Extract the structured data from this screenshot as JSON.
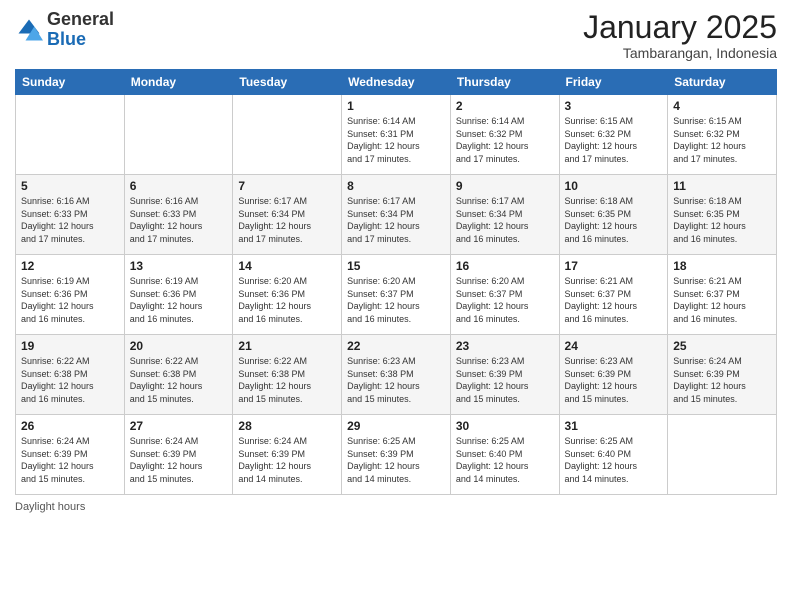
{
  "header": {
    "logo_general": "General",
    "logo_blue": "Blue",
    "month_title": "January 2025",
    "subtitle": "Tambarangan, Indonesia"
  },
  "days_of_week": [
    "Sunday",
    "Monday",
    "Tuesday",
    "Wednesday",
    "Thursday",
    "Friday",
    "Saturday"
  ],
  "weeks": [
    {
      "shade": "white",
      "days": [
        {
          "num": "",
          "info": ""
        },
        {
          "num": "",
          "info": ""
        },
        {
          "num": "",
          "info": ""
        },
        {
          "num": "1",
          "info": "Sunrise: 6:14 AM\nSunset: 6:31 PM\nDaylight: 12 hours\nand 17 minutes."
        },
        {
          "num": "2",
          "info": "Sunrise: 6:14 AM\nSunset: 6:32 PM\nDaylight: 12 hours\nand 17 minutes."
        },
        {
          "num": "3",
          "info": "Sunrise: 6:15 AM\nSunset: 6:32 PM\nDaylight: 12 hours\nand 17 minutes."
        },
        {
          "num": "4",
          "info": "Sunrise: 6:15 AM\nSunset: 6:32 PM\nDaylight: 12 hours\nand 17 minutes."
        }
      ]
    },
    {
      "shade": "shade",
      "days": [
        {
          "num": "5",
          "info": "Sunrise: 6:16 AM\nSunset: 6:33 PM\nDaylight: 12 hours\nand 17 minutes."
        },
        {
          "num": "6",
          "info": "Sunrise: 6:16 AM\nSunset: 6:33 PM\nDaylight: 12 hours\nand 17 minutes."
        },
        {
          "num": "7",
          "info": "Sunrise: 6:17 AM\nSunset: 6:34 PM\nDaylight: 12 hours\nand 17 minutes."
        },
        {
          "num": "8",
          "info": "Sunrise: 6:17 AM\nSunset: 6:34 PM\nDaylight: 12 hours\nand 17 minutes."
        },
        {
          "num": "9",
          "info": "Sunrise: 6:17 AM\nSunset: 6:34 PM\nDaylight: 12 hours\nand 16 minutes."
        },
        {
          "num": "10",
          "info": "Sunrise: 6:18 AM\nSunset: 6:35 PM\nDaylight: 12 hours\nand 16 minutes."
        },
        {
          "num": "11",
          "info": "Sunrise: 6:18 AM\nSunset: 6:35 PM\nDaylight: 12 hours\nand 16 minutes."
        }
      ]
    },
    {
      "shade": "white",
      "days": [
        {
          "num": "12",
          "info": "Sunrise: 6:19 AM\nSunset: 6:36 PM\nDaylight: 12 hours\nand 16 minutes."
        },
        {
          "num": "13",
          "info": "Sunrise: 6:19 AM\nSunset: 6:36 PM\nDaylight: 12 hours\nand 16 minutes."
        },
        {
          "num": "14",
          "info": "Sunrise: 6:20 AM\nSunset: 6:36 PM\nDaylight: 12 hours\nand 16 minutes."
        },
        {
          "num": "15",
          "info": "Sunrise: 6:20 AM\nSunset: 6:37 PM\nDaylight: 12 hours\nand 16 minutes."
        },
        {
          "num": "16",
          "info": "Sunrise: 6:20 AM\nSunset: 6:37 PM\nDaylight: 12 hours\nand 16 minutes."
        },
        {
          "num": "17",
          "info": "Sunrise: 6:21 AM\nSunset: 6:37 PM\nDaylight: 12 hours\nand 16 minutes."
        },
        {
          "num": "18",
          "info": "Sunrise: 6:21 AM\nSunset: 6:37 PM\nDaylight: 12 hours\nand 16 minutes."
        }
      ]
    },
    {
      "shade": "shade",
      "days": [
        {
          "num": "19",
          "info": "Sunrise: 6:22 AM\nSunset: 6:38 PM\nDaylight: 12 hours\nand 16 minutes."
        },
        {
          "num": "20",
          "info": "Sunrise: 6:22 AM\nSunset: 6:38 PM\nDaylight: 12 hours\nand 15 minutes."
        },
        {
          "num": "21",
          "info": "Sunrise: 6:22 AM\nSunset: 6:38 PM\nDaylight: 12 hours\nand 15 minutes."
        },
        {
          "num": "22",
          "info": "Sunrise: 6:23 AM\nSunset: 6:38 PM\nDaylight: 12 hours\nand 15 minutes."
        },
        {
          "num": "23",
          "info": "Sunrise: 6:23 AM\nSunset: 6:39 PM\nDaylight: 12 hours\nand 15 minutes."
        },
        {
          "num": "24",
          "info": "Sunrise: 6:23 AM\nSunset: 6:39 PM\nDaylight: 12 hours\nand 15 minutes."
        },
        {
          "num": "25",
          "info": "Sunrise: 6:24 AM\nSunset: 6:39 PM\nDaylight: 12 hours\nand 15 minutes."
        }
      ]
    },
    {
      "shade": "white",
      "days": [
        {
          "num": "26",
          "info": "Sunrise: 6:24 AM\nSunset: 6:39 PM\nDaylight: 12 hours\nand 15 minutes."
        },
        {
          "num": "27",
          "info": "Sunrise: 6:24 AM\nSunset: 6:39 PM\nDaylight: 12 hours\nand 15 minutes."
        },
        {
          "num": "28",
          "info": "Sunrise: 6:24 AM\nSunset: 6:39 PM\nDaylight: 12 hours\nand 14 minutes."
        },
        {
          "num": "29",
          "info": "Sunrise: 6:25 AM\nSunset: 6:39 PM\nDaylight: 12 hours\nand 14 minutes."
        },
        {
          "num": "30",
          "info": "Sunrise: 6:25 AM\nSunset: 6:40 PM\nDaylight: 12 hours\nand 14 minutes."
        },
        {
          "num": "31",
          "info": "Sunrise: 6:25 AM\nSunset: 6:40 PM\nDaylight: 12 hours\nand 14 minutes."
        },
        {
          "num": "",
          "info": ""
        }
      ]
    }
  ],
  "footer": {
    "daylight_label": "Daylight hours"
  }
}
